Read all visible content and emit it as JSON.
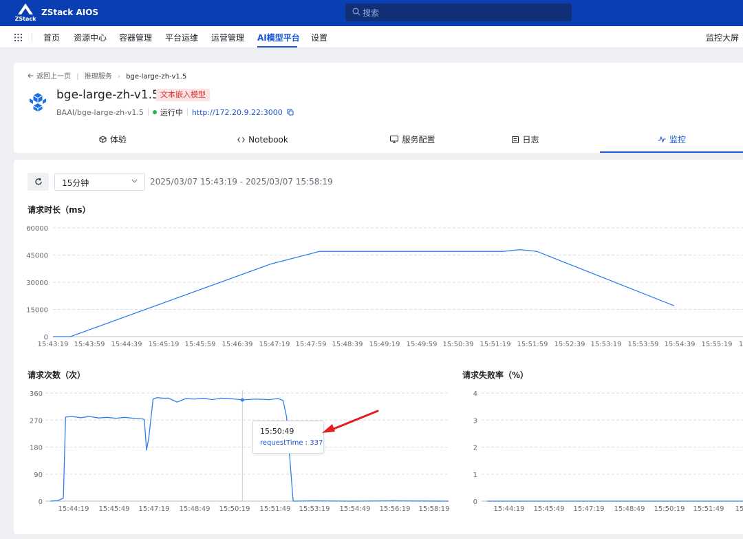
{
  "app": {
    "logo_text": "ZStack",
    "title": "ZStack AIOS"
  },
  "search": {
    "placeholder": "搜索"
  },
  "nav": {
    "items": [
      "首页",
      "资源中心",
      "容器管理",
      "平台运维",
      "运营管理",
      "AI模型平台",
      "设置"
    ],
    "active": "AI模型平台",
    "right": "监控大屏"
  },
  "breadcrumb": {
    "back": "返回上一页",
    "parent": "推理服务",
    "current": "bge-large-zh-v1.5"
  },
  "model": {
    "name": "bge-large-zh-v1.5",
    "tag": "文本嵌入模型",
    "source": "BAAI/bge-large-zh-v1.5",
    "status": "运行中",
    "url": "http://172.20.9.22:3000"
  },
  "tabs": [
    "体验",
    "Notebook",
    "服务配置",
    "日志",
    "监控"
  ],
  "active_tab": "监控",
  "toolbar": {
    "range": "15分钟",
    "time_range": "2025/03/07 15:43:19 - 2025/03/07 15:58:19"
  },
  "tooltip": {
    "time": "15:50:49",
    "series": "requestTime",
    "value": "337"
  },
  "colors": {
    "brand": "#0a3eb3",
    "accent": "#1a54d4",
    "line": "#2f7fe8",
    "tag_bg": "#fde2e2",
    "tag_text": "#d4333a",
    "status_ok": "#2bb34b"
  },
  "chart_data": [
    {
      "type": "line",
      "title": "请求时长（ms）",
      "ylim": [
        0,
        60000
      ],
      "yticks": [
        0,
        15000,
        30000,
        45000,
        60000
      ],
      "xticks": [
        "15:43:19",
        "15:43:59",
        "15:44:39",
        "15:45:19",
        "15:45:59",
        "15:46:39",
        "15:47:19",
        "15:47:59",
        "15:48:39",
        "15:49:19",
        "15:49:59",
        "15:50:39",
        "15:51:19",
        "15:51:59",
        "15:52:39",
        "15:53:19",
        "15:53:59",
        "15:54:39",
        "15:55:19",
        "1"
      ],
      "x": [
        "15:43:19",
        "15:43:40",
        "15:47:40",
        "15:48:39",
        "15:52:20",
        "15:52:40",
        "15:53:00",
        "15:55:45"
      ],
      "values": [
        0,
        0,
        40000,
        47000,
        47000,
        48000,
        47000,
        17000
      ]
    },
    {
      "type": "line",
      "title": "请求次数（次）",
      "ylim": [
        0,
        360
      ],
      "yticks": [
        0,
        90,
        180,
        270,
        360
      ],
      "xticks": [
        "15:44:19",
        "15:45:49",
        "15:47:19",
        "15:48:49",
        "15:50:19",
        "15:51:49",
        "15:53:19",
        "15:54:49",
        "15:56:19",
        "15:58:19"
      ],
      "x": [
        "15:43:30",
        "15:43:48",
        "15:44:00",
        "15:44:05",
        "15:44:20",
        "15:44:40",
        "15:45:00",
        "15:45:20",
        "15:45:40",
        "15:46:00",
        "15:46:20",
        "15:46:40",
        "15:47:00",
        "15:47:05",
        "15:47:10",
        "15:47:15",
        "15:47:25",
        "15:47:35",
        "15:47:45",
        "15:48:00",
        "15:48:20",
        "15:48:40",
        "15:49:00",
        "15:49:20",
        "15:49:40",
        "15:50:00",
        "15:50:20",
        "15:50:49",
        "15:51:20",
        "15:51:50",
        "15:52:10",
        "15:52:22",
        "15:52:30",
        "15:52:45",
        "15:53:30",
        "15:55:00",
        "15:56:30",
        "15:58:40"
      ],
      "values": [
        0,
        2,
        10,
        280,
        282,
        278,
        282,
        277,
        279,
        276,
        279,
        276,
        274,
        272,
        170,
        210,
        340,
        345,
        343,
        343,
        330,
        342,
        340,
        343,
        338,
        343,
        342,
        337,
        340,
        338,
        342,
        335,
        280,
        0,
        1,
        0,
        1,
        0
      ]
    },
    {
      "type": "line",
      "title": "请求失败率（%）",
      "ylim": [
        0,
        4
      ],
      "yticks": [
        0,
        1,
        2,
        3,
        4
      ],
      "xticks": [
        "15:44:19",
        "15:45:49",
        "15:47:19",
        "15:48:49",
        "15:50:19",
        "15:51:49",
        "15"
      ],
      "x": [
        "15:43:30",
        "15:53:30"
      ],
      "values": [
        0,
        0
      ]
    }
  ]
}
